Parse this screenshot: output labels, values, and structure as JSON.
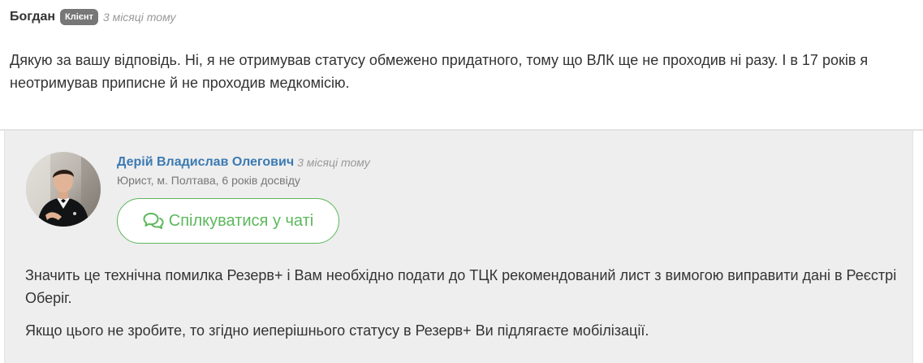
{
  "client_comment": {
    "author": "Богдан",
    "badge": "Клієнт",
    "time": "3 місяці тому",
    "text": "Дякую за вашу відповідь. Ні, я не отримував статусу обмежено придатного, тому що ВЛК ще не проходив ні разу. І в 17 років я неотримував приписне й не проходив медкомісію."
  },
  "lawyer_comment": {
    "author": "Дерій Владислав Олегович",
    "time": "3 місяці тому",
    "meta": "Юрист, м. Полтава, 6 років досвіду",
    "chat_button_label": "Спілкуватися у чаті",
    "chat_icon": "comments-icon",
    "paragraphs": [
      "Значить це технічна помилка Резерв+ і Вам необхідно подати до ТЦК рекомендований лист з вимогою виправити дані в Реєстрі Оберіг.",
      "Якщо цього не зробите, то згідно иеперішнього статусу в Резерв+ Ви підлягаєте мобілізації."
    ]
  },
  "colors": {
    "link": "#3b7ab3",
    "accent_green": "#5cb85c",
    "badge_bg": "#777777",
    "reply_bg": "#eeeeee"
  }
}
